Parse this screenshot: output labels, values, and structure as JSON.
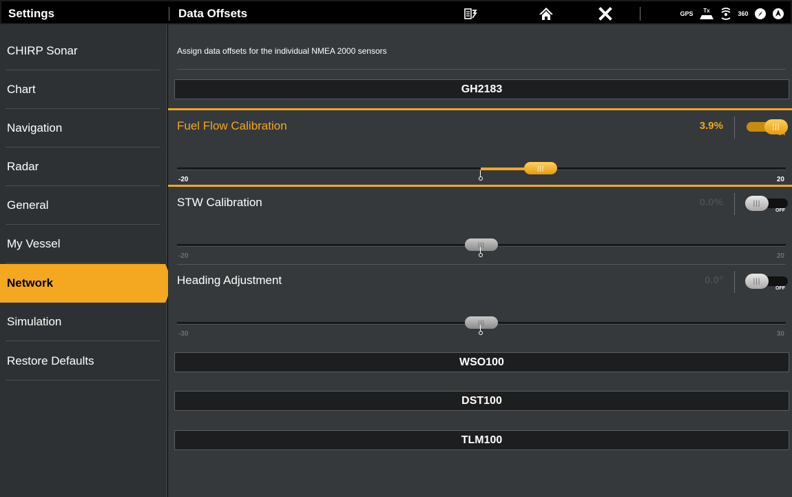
{
  "topbar": {
    "left_title": "Settings",
    "main_title": "Data Offsets",
    "icons": [
      "exit-icon",
      "home-icon",
      "close-icon"
    ],
    "status": {
      "gps_label": "GPS",
      "tx_label": "Tx",
      "label_360": "360"
    }
  },
  "sidebar": {
    "items": [
      {
        "label": "CHIRP Sonar"
      },
      {
        "label": "Chart"
      },
      {
        "label": "Navigation"
      },
      {
        "label": "Radar"
      },
      {
        "label": "General"
      },
      {
        "label": "My Vessel"
      },
      {
        "label": "Network",
        "active": true
      },
      {
        "label": "Simulation"
      },
      {
        "label": "Restore Defaults"
      }
    ]
  },
  "main": {
    "description": "Assign data offsets for the individual NMEA 2000 sensors",
    "sensors": [
      {
        "name": "GH2183"
      },
      {
        "name": "WSO100"
      },
      {
        "name": "DST100"
      },
      {
        "name": "TLM100"
      }
    ],
    "settings": [
      {
        "label": "Fuel Flow Calibration",
        "value_text": "3.9%",
        "value": 3.9,
        "min": -20,
        "max": 20,
        "min_label": "-20",
        "max_label": "20",
        "toggle_state": "ON",
        "toggle_on": true,
        "selected": true
      },
      {
        "label": "STW Calibration",
        "value_text": "0.0%",
        "value": 0.0,
        "min": -20,
        "max": 20,
        "min_label": "-20",
        "max_label": "20",
        "toggle_state": "OFF",
        "toggle_on": false,
        "selected": false
      },
      {
        "label": "Heading Adjustment",
        "value_text": "0.0°",
        "value": 0.0,
        "min": -30,
        "max": 30,
        "min_label": "-30",
        "max_label": "30",
        "toggle_state": "OFF",
        "toggle_on": false,
        "selected": false
      }
    ]
  },
  "colors": {
    "accent": "#f3a81f",
    "sidebar_bg": "#2e3133",
    "main_bg": "#35393b",
    "sensor_bar_bg": "#1c1e1f"
  }
}
